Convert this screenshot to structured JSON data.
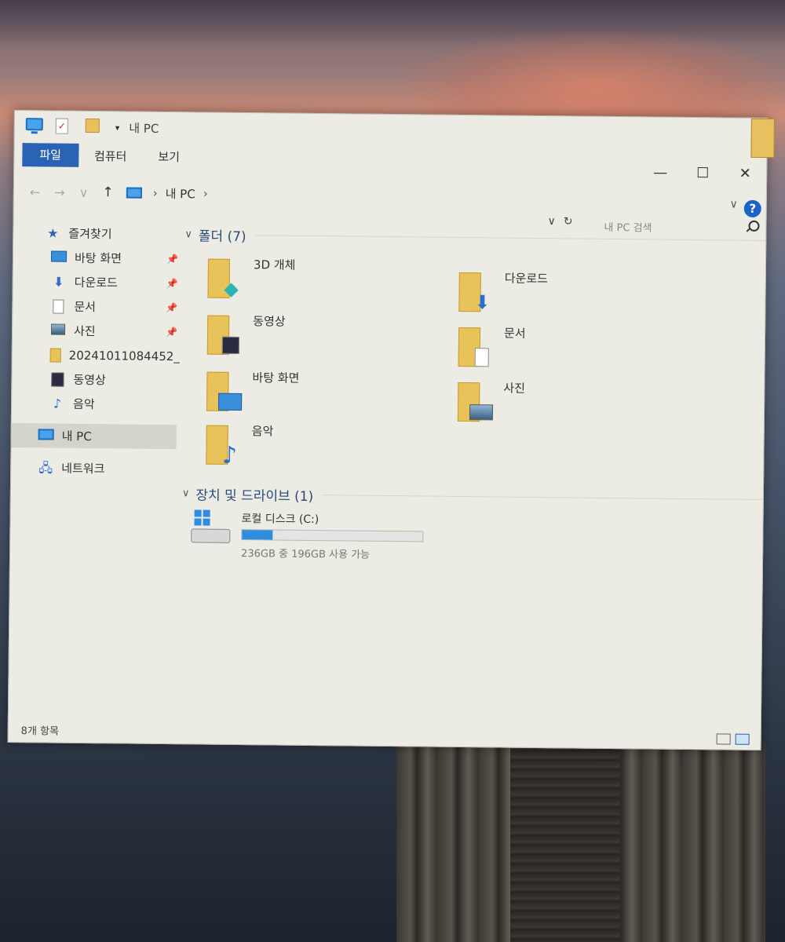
{
  "window": {
    "title": "내 PC"
  },
  "ribbon": {
    "tabs": [
      "파일",
      "컴퓨터",
      "보기"
    ]
  },
  "controls": {
    "minimize": "—",
    "maximize": "☐",
    "close": "✕",
    "help": "?"
  },
  "address": {
    "path": [
      "내 PC"
    ],
    "search_placeholder": "내 PC 검색"
  },
  "sidebar": {
    "quick_access": "즐겨찾기",
    "items": [
      {
        "label": "바탕 화면",
        "pinned": true
      },
      {
        "label": "다운로드",
        "pinned": true
      },
      {
        "label": "문서",
        "pinned": true
      },
      {
        "label": "사진",
        "pinned": true
      },
      {
        "label": "20241011084452_",
        "pinned": false
      },
      {
        "label": "동영상",
        "pinned": false
      },
      {
        "label": "음악",
        "pinned": false
      }
    ],
    "this_pc": "내 PC",
    "network": "네트워크"
  },
  "content": {
    "folders_header": "폴더 (7)",
    "folders": [
      {
        "label": "3D 개체",
        "icon": "3d-objects-icon"
      },
      {
        "label": "다운로드",
        "icon": "download-icon"
      },
      {
        "label": "동영상",
        "icon": "video-icon"
      },
      {
        "label": "문서",
        "icon": "document-icon"
      },
      {
        "label": "바탕 화면",
        "icon": "desktop-icon"
      },
      {
        "label": "사진",
        "icon": "picture-icon"
      },
      {
        "label": "음악",
        "icon": "music-icon"
      }
    ],
    "drives_header": "장치 및 드라이브 (1)",
    "drive": {
      "name": "로컬 디스크 (C:)",
      "usage_text": "236GB 중 196GB 사용 가능",
      "used_fraction": 0.17
    }
  },
  "status": {
    "item_count": "8개 항목"
  },
  "colors": {
    "accent": "#2a63b3",
    "folder": "#e8c35a",
    "drive_bar": "#2f8de0"
  }
}
